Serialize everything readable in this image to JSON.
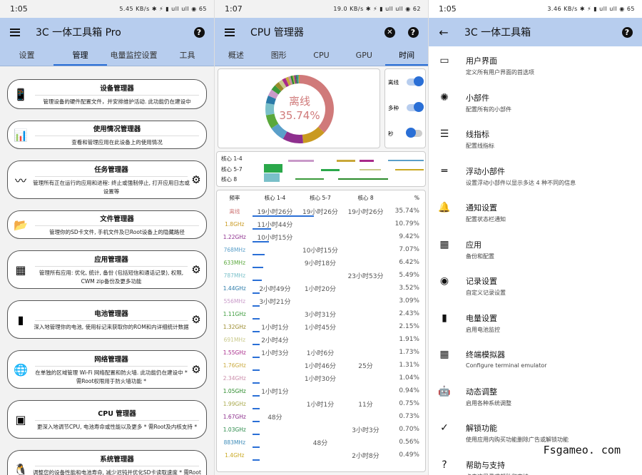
{
  "screen1": {
    "time": "1:05",
    "status_icons": "5.45 KB/s ✱ ⚡ ▮ ull ull ◉ 65",
    "title": "3C 一体工具箱 Pro",
    "tabs": [
      "设置",
      "管理",
      "电量监控设置",
      "工具"
    ],
    "active_tab": 1,
    "cards": [
      {
        "icon": "📱",
        "title": "设备管理器",
        "desc": "管理设备的硬件配置文件，并安排维护活动. 此功能仍在建设中",
        "gear": false
      },
      {
        "icon": "📊",
        "title": "使用情况管理器",
        "desc": "查看和管理应用在此设备上的使用情况",
        "gear": false
      },
      {
        "icon": "〰",
        "title": "任务管理器",
        "desc": "管理所有正在运行的应用和进程: 终止或强制停止, 打开应用日志或设置等",
        "gear": true
      },
      {
        "icon": "📂",
        "title": "文件管理器",
        "desc": "管理你的SD卡文件, 手机文件及已Root设备上的隐藏路径",
        "gear": false
      },
      {
        "icon": "▦",
        "title": "应用管理器",
        "desc": "管理所有应用: 优化, 统计, 备份 (包括短信和通话记录), 权限, CWM zip备份及更多功能",
        "gear": true
      },
      {
        "icon": "▮",
        "title": "电池管理器",
        "desc": "深入地管理你的电池, 使用标记来获取你的ROM和内详细统计数据",
        "gear": true
      },
      {
        "icon": "🌐",
        "title": "网络管理器",
        "desc": "在单独的区域管理 Wi-Fi 网络配置和防火墙. 此功能仍在建设中 * 需Root权限用于防火墙功能 *",
        "gear": true
      },
      {
        "icon": "▣",
        "title": "CPU 管理器",
        "desc": "更深入地调节CPU, 电池寿命或性能以及更多 * 需Root及内核支持 *",
        "gear": false
      },
      {
        "icon": "🐧",
        "title": "系统管理器",
        "desc": "调整您的设备性能和电池寿命, 减少迟钝并优化SD卡读取速度 * 需Root *",
        "gear": false
      }
    ]
  },
  "screen2": {
    "time": "1:07",
    "status_icons": "19.0 KB/s ✱ ⚡ ▮ ull ull ◉ 62",
    "title": "CPU 管理器",
    "tabs": [
      "概述",
      "图形",
      "CPU",
      "GPU",
      "时间"
    ],
    "active_tab": 4,
    "donut_label": "离线",
    "donut_value": "35.74%",
    "toggles": [
      {
        "label": "离线",
        "on": true
      },
      {
        "label": "多种",
        "on": true
      },
      {
        "label": "秒",
        "on": false
      }
    ],
    "core_labels": [
      "核心 1-4",
      "核心 5-7",
      "核心 8"
    ],
    "table_header": [
      "频率",
      "核心 1-4",
      "核心 5-7",
      "核心 8",
      "%"
    ],
    "rows": [
      {
        "f": "离线",
        "c": "#d07a7a",
        "a": "19小时26分",
        "b": "19小时26分",
        "d": "19小时26分",
        "p": "35.74%",
        "bar": 0.36
      },
      {
        "f": "1.8GHz",
        "c": "#c99a20",
        "a": "11小时44分",
        "b": "",
        "d": "",
        "p": "10.79%",
        "bar": 0.11
      },
      {
        "f": "1.22GHz",
        "c": "#8e2f8e",
        "a": "10小时15分",
        "b": "",
        "d": "",
        "p": "9.42%",
        "bar": 0.094
      },
      {
        "f": "768MHz",
        "c": "#5a9fc9",
        "a": "",
        "b": "10小时15分",
        "d": "",
        "p": "7.07%",
        "bar": 0.07
      },
      {
        "f": "633MHz",
        "c": "#5aa83c",
        "a": "",
        "b": "9小时18分",
        "d": "",
        "p": "6.42%",
        "bar": 0.064
      },
      {
        "f": "787MHz",
        "c": "#7ac0c9",
        "a": "",
        "b": "",
        "d": "23小时53分",
        "p": "5.49%",
        "bar": 0.055
      },
      {
        "f": "1.44GHz",
        "c": "#2a7aa8",
        "a": "2小时49分",
        "b": "1小时20分",
        "d": "",
        "p": "3.52%",
        "bar": 0.035
      },
      {
        "f": "556MHz",
        "c": "#c99ac9",
        "a": "3小时21分",
        "b": "",
        "d": "",
        "p": "3.09%",
        "bar": 0.031
      },
      {
        "f": "1.11GHz",
        "c": "#3a9a3a",
        "a": "",
        "b": "3小时31分",
        "d": "",
        "p": "2.43%",
        "bar": 0.024
      },
      {
        "f": "1.32GHz",
        "c": "#9a8a2a",
        "a": "1小时1分",
        "b": "1小时45分",
        "d": "",
        "p": "2.15%",
        "bar": 0.021
      },
      {
        "f": "691MHz",
        "c": "#c9c98a",
        "a": "2小时4分",
        "b": "",
        "d": "",
        "p": "1.91%",
        "bar": 0.019
      },
      {
        "f": "1.55GHz",
        "c": "#a82a8a",
        "a": "1小时3分",
        "b": "1小时6分",
        "d": "",
        "p": "1.73%",
        "bar": 0.017
      },
      {
        "f": "1.76GHz",
        "c": "#c9a83a",
        "a": "",
        "b": "1小时46分",
        "d": "25分",
        "p": "1.31%",
        "bar": 0.013
      },
      {
        "f": "2.34GHz",
        "c": "#c98aa8",
        "a": "",
        "b": "1小时30分",
        "d": "",
        "p": "1.04%",
        "bar": 0.01
      },
      {
        "f": "1.05GHz",
        "c": "#2a8a2a",
        "a": "1小时1分",
        "b": "",
        "d": "",
        "p": "0.94%",
        "bar": 0.009
      },
      {
        "f": "1.99GHz",
        "c": "#a8a84a",
        "a": "",
        "b": "1小时1分",
        "d": "11分",
        "p": "0.75%",
        "bar": 0.0075
      },
      {
        "f": "1.67GHz",
        "c": "#8a2a8a",
        "a": "48分",
        "b": "",
        "d": "",
        "p": "0.73%",
        "bar": 0.0073
      },
      {
        "f": "1.03GHz",
        "c": "#2a8a4a",
        "a": "",
        "b": "",
        "d": "3小时3分",
        "p": "0.70%",
        "bar": 0.007
      },
      {
        "f": "883MHz",
        "c": "#3a8ab8",
        "a": "",
        "b": "48分",
        "d": "",
        "p": "0.56%",
        "bar": 0.0056
      },
      {
        "f": "1.4GHz",
        "c": "#c9a820",
        "a": "",
        "b": "",
        "d": "2小时8分",
        "p": "0.49%",
        "bar": 0.0049
      }
    ]
  },
  "screen3": {
    "time": "1:05",
    "status_icons": "3.46 KB/s ✱ ⚡ ▮ ull ull ◉ 65",
    "title": "3C 一体工具箱",
    "items": [
      {
        "icon": "▭",
        "t": "用户界面",
        "d": "定义所有用户界面的首选项"
      },
      {
        "icon": "✺",
        "t": "小部件",
        "d": "配置所有的小部件"
      },
      {
        "icon": "☰",
        "t": "线指标",
        "d": "配置线指标"
      },
      {
        "icon": "═",
        "t": "浮动小部件",
        "d": "设置浮动小部件以显示多达 4 种不同的信息"
      },
      {
        "icon": "🔔",
        "t": "通知设置",
        "d": "配置状态栏通知"
      },
      {
        "icon": "▦",
        "t": "应用",
        "d": "备份和配置"
      },
      {
        "icon": "◉",
        "t": "记录设置",
        "d": "自定义记录设置"
      },
      {
        "icon": "▮",
        "t": "电量设置",
        "d": "启用电池监控"
      },
      {
        "icon": "▦",
        "t": "终端模拟器",
        "d": "Configure terminal emulator"
      },
      {
        "icon": "🤖",
        "t": "动态调整",
        "d": "启用各种系统调整"
      },
      {
        "icon": "✓",
        "t": "解锁功能",
        "d": "使用应用内购买功能删除广告或解锁功能"
      },
      {
        "icon": "?",
        "t": "帮助与支持",
        "d": "点击这里寻求帮助和支持"
      }
    ]
  },
  "watermark": "Fsgameo. com"
}
